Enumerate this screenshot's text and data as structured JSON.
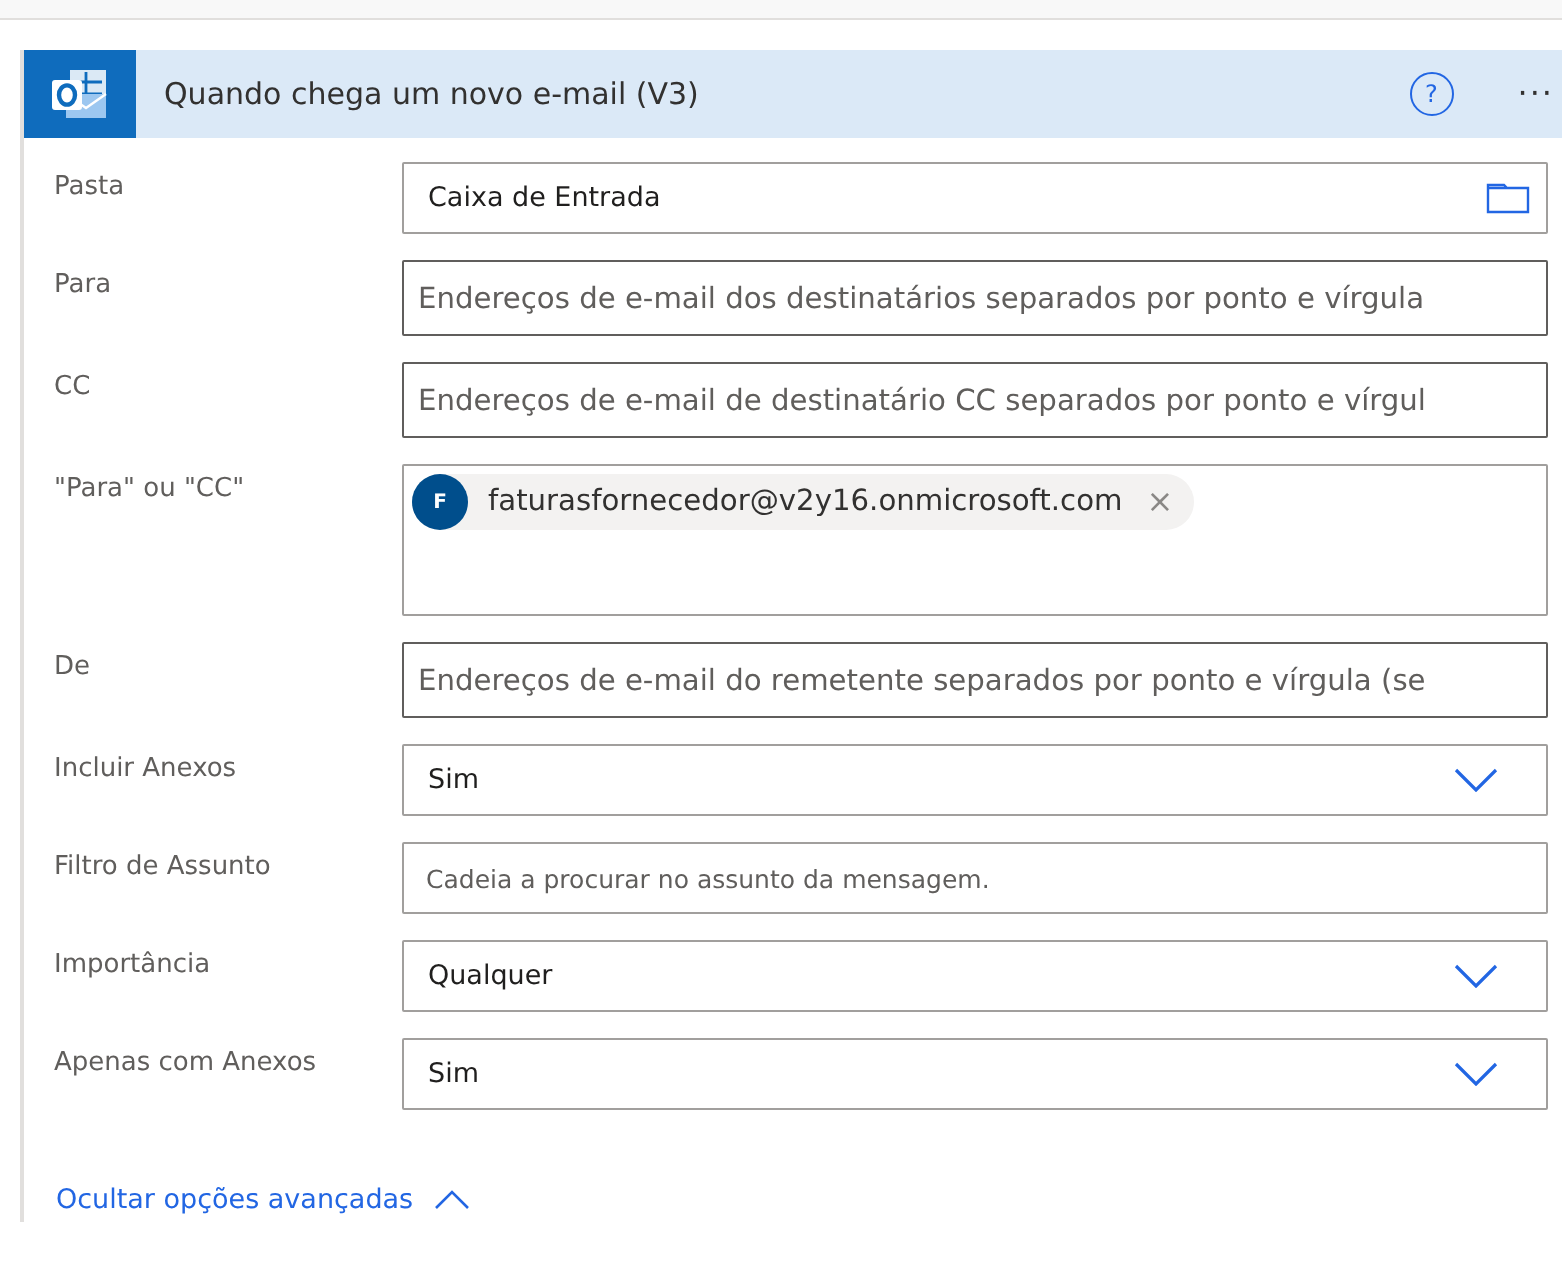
{
  "card": {
    "title": "Quando chega um novo e-mail (V3)",
    "help": "?",
    "more": "···"
  },
  "fields": [
    {
      "label": "Pasta",
      "kind": "picker",
      "value": "Caixa de Entrada"
    },
    {
      "label": "Para",
      "kind": "address",
      "placeholder": "Endereços de e-mail dos destinatários separados por ponto e vírgula"
    },
    {
      "label": "CC",
      "kind": "address",
      "placeholder": "Endereços de e-mail de destinatário CC separados por ponto e vírgul"
    },
    {
      "label": "\"Para\" ou \"CC\"",
      "kind": "tags",
      "tags": [
        {
          "initial": "F",
          "text": "faturasfornecedor@v2y16.onmicrosoft.com",
          "remove": "×"
        }
      ]
    },
    {
      "label": "De",
      "kind": "address",
      "placeholder": "Endereços de e-mail do remetente separados por ponto e vírgula (se"
    },
    {
      "label": "Incluir Anexos",
      "kind": "dropdown",
      "value": "Sim"
    },
    {
      "label": "Filtro de Assunto",
      "kind": "text",
      "placeholder": "Cadeia a procurar no assunto da mensagem."
    },
    {
      "label": "Importância",
      "kind": "dropdown",
      "value": "Qualquer"
    },
    {
      "label": "Apenas com Anexos",
      "kind": "dropdown",
      "value": "Sim"
    }
  ],
  "advanced_link": {
    "label": "Ocultar opções avançadas",
    "expanded": true
  }
}
